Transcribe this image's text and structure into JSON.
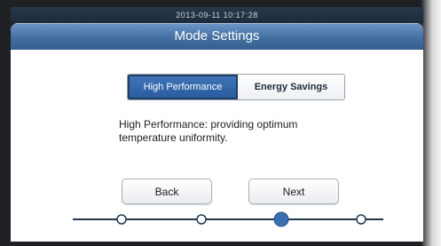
{
  "statusbar": {
    "datetime": "2013-09-11   10:17:28"
  },
  "window": {
    "title": "Mode Settings"
  },
  "mode_toggle": {
    "options": [
      "High Performance",
      "Energy Savings"
    ],
    "selected": "High Performance"
  },
  "description": "High Performance: providing optimum temperature uniformity.",
  "nav": {
    "back_label": "Back",
    "next_label": "Next"
  },
  "wizard_progress": {
    "total_steps": 4,
    "current_step": 3
  },
  "colors": {
    "accent": "#3f6b9d",
    "step_active": "#3a6fb0",
    "track": "#22384f"
  }
}
